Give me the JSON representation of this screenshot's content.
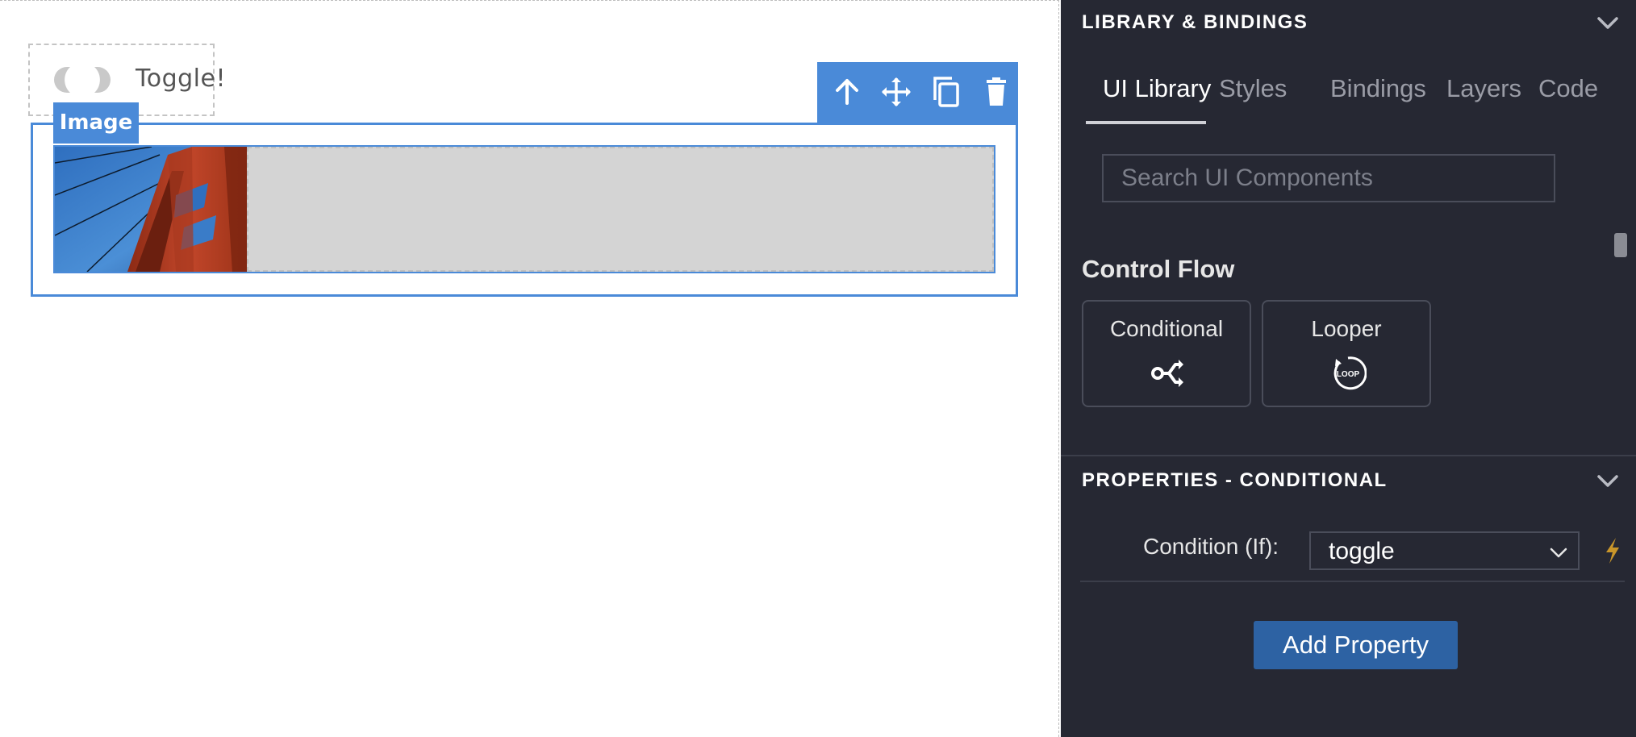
{
  "canvas": {
    "toggle": {
      "label": "Toggle!"
    },
    "image_tag": "Image"
  },
  "panel": {
    "library_header": "LIBRARY & BINDINGS",
    "tabs": [
      {
        "label": "UI Library",
        "active": true
      },
      {
        "label": "Styles",
        "active": false
      },
      {
        "label": "Bindings",
        "active": false
      },
      {
        "label": "Layers",
        "active": false
      },
      {
        "label": "Code",
        "active": false
      }
    ],
    "search": {
      "placeholder": "Search UI Components",
      "value": ""
    },
    "control_flow": {
      "title": "Control Flow",
      "items": [
        {
          "label": "Conditional",
          "icon": "conditional-icon"
        },
        {
          "label": "Looper",
          "icon": "loop-icon",
          "icon_text": "LOOP"
        }
      ]
    },
    "properties_header": "PROPERTIES - CONDITIONAL",
    "condition": {
      "label": "Condition (If):",
      "value": "toggle"
    },
    "add_property_label": "Add Property"
  },
  "colors": {
    "accent": "#4a8ad8",
    "panel_bg": "#262833",
    "button_bg": "#2d62a3",
    "bolt": "#c9962a"
  }
}
